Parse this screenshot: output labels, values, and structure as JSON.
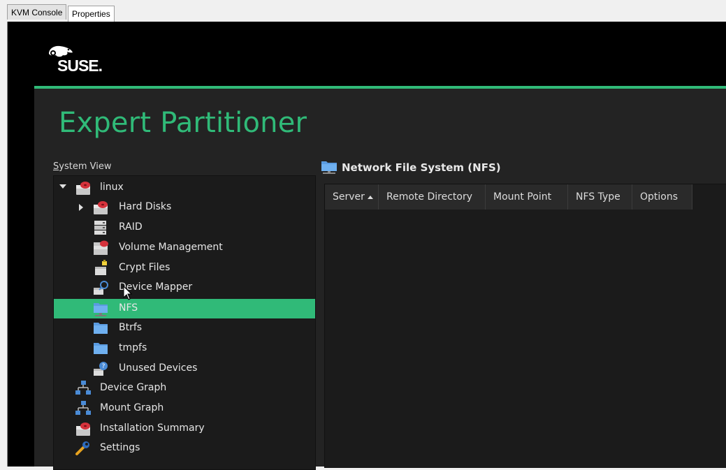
{
  "tabs": [
    {
      "label": "KVM Console",
      "active": false
    },
    {
      "label": "Properties",
      "active": true
    }
  ],
  "brand": {
    "logo_text": "SUSE.",
    "accent": "#30ba78"
  },
  "page": {
    "title": "Expert Partitioner"
  },
  "system_view": {
    "label_accel": "S",
    "label_rest": "ystem View",
    "items": [
      {
        "label": "linux",
        "icon": "hard-disk-icon",
        "expander": "expanded",
        "selected": false
      },
      {
        "label": "Hard Disks",
        "icon": "hard-disk-icon",
        "expander": "collapsed",
        "selected": false
      },
      {
        "label": "RAID",
        "icon": "raid-icon",
        "expander": null,
        "selected": false
      },
      {
        "label": "Volume Management",
        "icon": "volume-management-icon",
        "expander": null,
        "selected": false
      },
      {
        "label": "Crypt Files",
        "icon": "crypt-files-icon",
        "expander": null,
        "selected": false
      },
      {
        "label": "Device Mapper",
        "icon": "device-mapper-icon",
        "expander": null,
        "selected": false
      },
      {
        "label": "NFS",
        "icon": "network-folder-icon",
        "expander": null,
        "selected": true
      },
      {
        "label": "Btrfs",
        "icon": "folder-icon",
        "expander": null,
        "selected": false
      },
      {
        "label": "tmpfs",
        "icon": "folder-icon",
        "expander": null,
        "selected": false
      },
      {
        "label": "Unused Devices",
        "icon": "unused-devices-icon",
        "expander": null,
        "selected": false
      },
      {
        "label": "Device Graph",
        "icon": "graph-icon",
        "expander": null,
        "selected": false
      },
      {
        "label": "Mount Graph",
        "icon": "graph-icon",
        "expander": null,
        "selected": false
      },
      {
        "label": "Installation Summary",
        "icon": "hard-disk-icon",
        "expander": null,
        "selected": false
      },
      {
        "label": "Settings",
        "icon": "wrench-icon",
        "expander": null,
        "selected": false
      }
    ]
  },
  "nfs_panel": {
    "heading": "Network File System (NFS)",
    "icon": "network-folder-icon",
    "columns": [
      {
        "label": "Server",
        "sorted": "ascending"
      },
      {
        "label": "Remote Directory"
      },
      {
        "label": "Mount Point"
      },
      {
        "label": "NFS Type"
      },
      {
        "label": "Options"
      }
    ],
    "rows": []
  }
}
